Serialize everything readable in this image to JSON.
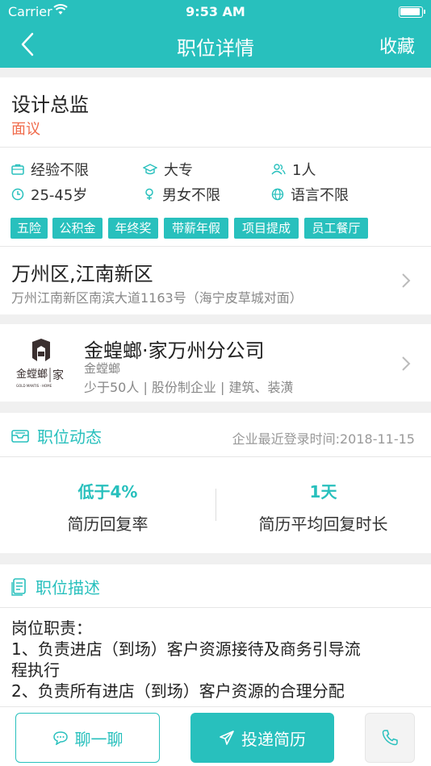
{
  "status_bar": {
    "carrier": "Carrier",
    "time": "9:53 AM"
  },
  "nav": {
    "title": "职位详情",
    "favorite": "收藏"
  },
  "job": {
    "title": "设计总监",
    "salary": "面议",
    "requirements": [
      "经验不限",
      "大专",
      "1人",
      "25-45岁",
      "男女不限",
      "语言不限"
    ],
    "benefits": [
      "五险",
      "公积金",
      "年终奖",
      "带薪年假",
      "项目提成",
      "员工餐厅"
    ]
  },
  "address": {
    "district": "万州区,江南新区",
    "detail": "万州江南新区南滨大道1163号（海宁皮草城对面）"
  },
  "company": {
    "name": "金蝗螂·家万州分公司",
    "short_name": "金螳螂",
    "info": "少于50人 | 股份制企业 | 建筑、装潢",
    "logo_text": "金螳螂",
    "logo_home": "家",
    "logo_sub": "GOLD MANTIS · HOME"
  },
  "dynamics": {
    "title": "职位动态",
    "last_login": "企业最近登录时间:2018-11-15",
    "stats": [
      {
        "value": "低于4%",
        "label": "简历回复率"
      },
      {
        "value": "1天",
        "label": "简历平均回复时长"
      }
    ]
  },
  "description": {
    "title": "职位描述",
    "lines": [
      "岗位职责：",
      "1、负责进店（到场）客户资源接待及商务引导流",
      "程执行",
      "2、负责所有进店（到场）客户资源的合理分配"
    ]
  },
  "actions": {
    "chat": "聊一聊",
    "apply": "投递简历"
  },
  "colors": {
    "accent": "#28c0bd",
    "salary": "#f06a4a"
  }
}
